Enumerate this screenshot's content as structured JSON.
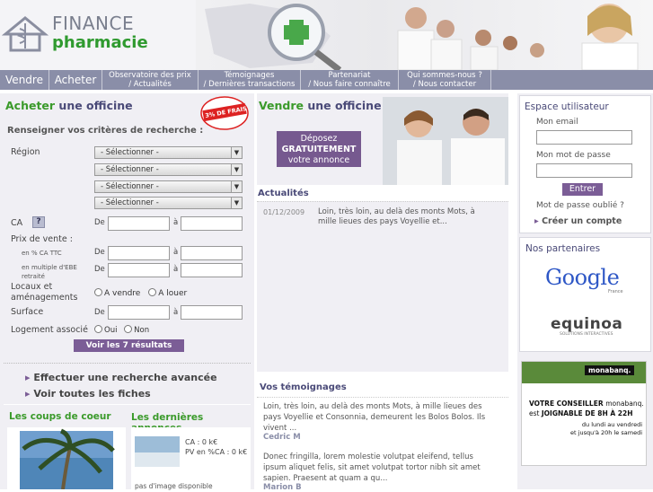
{
  "logo": {
    "line1": "FINANCE",
    "line2": "pharmacie"
  },
  "nav": {
    "vendre": "Vendre",
    "acheter": "Acheter",
    "observatoire_1": "Observatoire des prix",
    "observatoire_2": "/ Actualités",
    "temoignages_1": "Témoignages",
    "temoignages_2": "/ Dernières transactions",
    "partenariat_1": "Partenariat",
    "partenariat_2": "/ Nous faire connaître",
    "qui_1": "Qui sommes-nous ?",
    "qui_2": "/ Nous contacter"
  },
  "acheter": {
    "title_a": "Acheter",
    "title_b": " une officine",
    "badge": "3% DE FRAIS",
    "criteria": "Renseigner vos critères de recherche :",
    "region_label": "Région",
    "select_value": "- Sélectionner -",
    "ca_label": "CA",
    "ca_help": "?",
    "de": "De",
    "a": "à",
    "prix_label": "Prix de vente :",
    "prix_pct": "en % CA TTC",
    "prix_ebe_1": "en multiple d'EBE",
    "prix_ebe_2": "retraité",
    "locaux_1": "Locaux et",
    "locaux_2": "aménagements",
    "a_vendre": "A vendre",
    "a_louer": "A louer",
    "surface_label": "Surface",
    "logement_label": "Logement associé",
    "oui": "Oui",
    "non": "Non",
    "results_button": "Voir les 7 résultats",
    "advanced_link": "Effectuer une recherche avancée",
    "all_link": "Voir toutes les fiches",
    "coups_title": "Les coups de coeur",
    "annonces_title": "Les dernières annonces",
    "annonce_ca": "CA : 0 k€",
    "annonce_pv": "PV en %CA : 0 k€",
    "annonce_noimg": "pas d'image disponible"
  },
  "vendre": {
    "title_a": "Vendre",
    "title_b": " une officine",
    "cta_1": "Déposez",
    "cta_2": "GRATUITEMENT",
    "cta_3": "votre annonce"
  },
  "actualites": {
    "title": "Actualités",
    "date": "01/12/2009",
    "text": "Loin, très loin, au delà des monts Mots, à mille lieues des pays Voyellie et..."
  },
  "temoignages": {
    "title": "Vos témoignages",
    "t1": "Loin, très loin, au delà des monts Mots, à mille lieues des pays Voyellie et Consonnia, demeurent les Bolos Bolos. Ils vivent ...",
    "a1": "Cedric M",
    "t2": "Donec fringilla, lorem molestie volutpat eleifend, tellus ipsum aliquet felis, sit amet volutpat tortor nibh sit amet sapien. Praesent at quam a qu...",
    "a2": "Marion B"
  },
  "espace": {
    "title": "Espace utilisateur",
    "email_label": "Mon email",
    "password_label": "Mon mot de passe",
    "login_button": "Entrer",
    "forgot": "Mot de passe oublié ?",
    "create": "Créer un compte"
  },
  "partenaires": {
    "title": "Nos partenaires",
    "google": "Google",
    "google_sub": "France",
    "equinoa": "equinoa",
    "equinoa_sub": "SOLUTIONS INTERACTIVES"
  },
  "pub": {
    "brand": "monabanq.",
    "line1": "VOTRE CONSEILLER",
    "brand_inline": "monabanq.",
    "line2a": "est",
    "line2b": "JOIGNABLE DE 8H À 22H",
    "line3": "du lundi au vendredi",
    "line4": "et jusqu'à 20h le samedi"
  },
  "colors": {
    "nav": "#8a8ea8",
    "green": "#3a9a2a",
    "purple": "#7b5d96",
    "panel_bg": "#f0eff4"
  }
}
